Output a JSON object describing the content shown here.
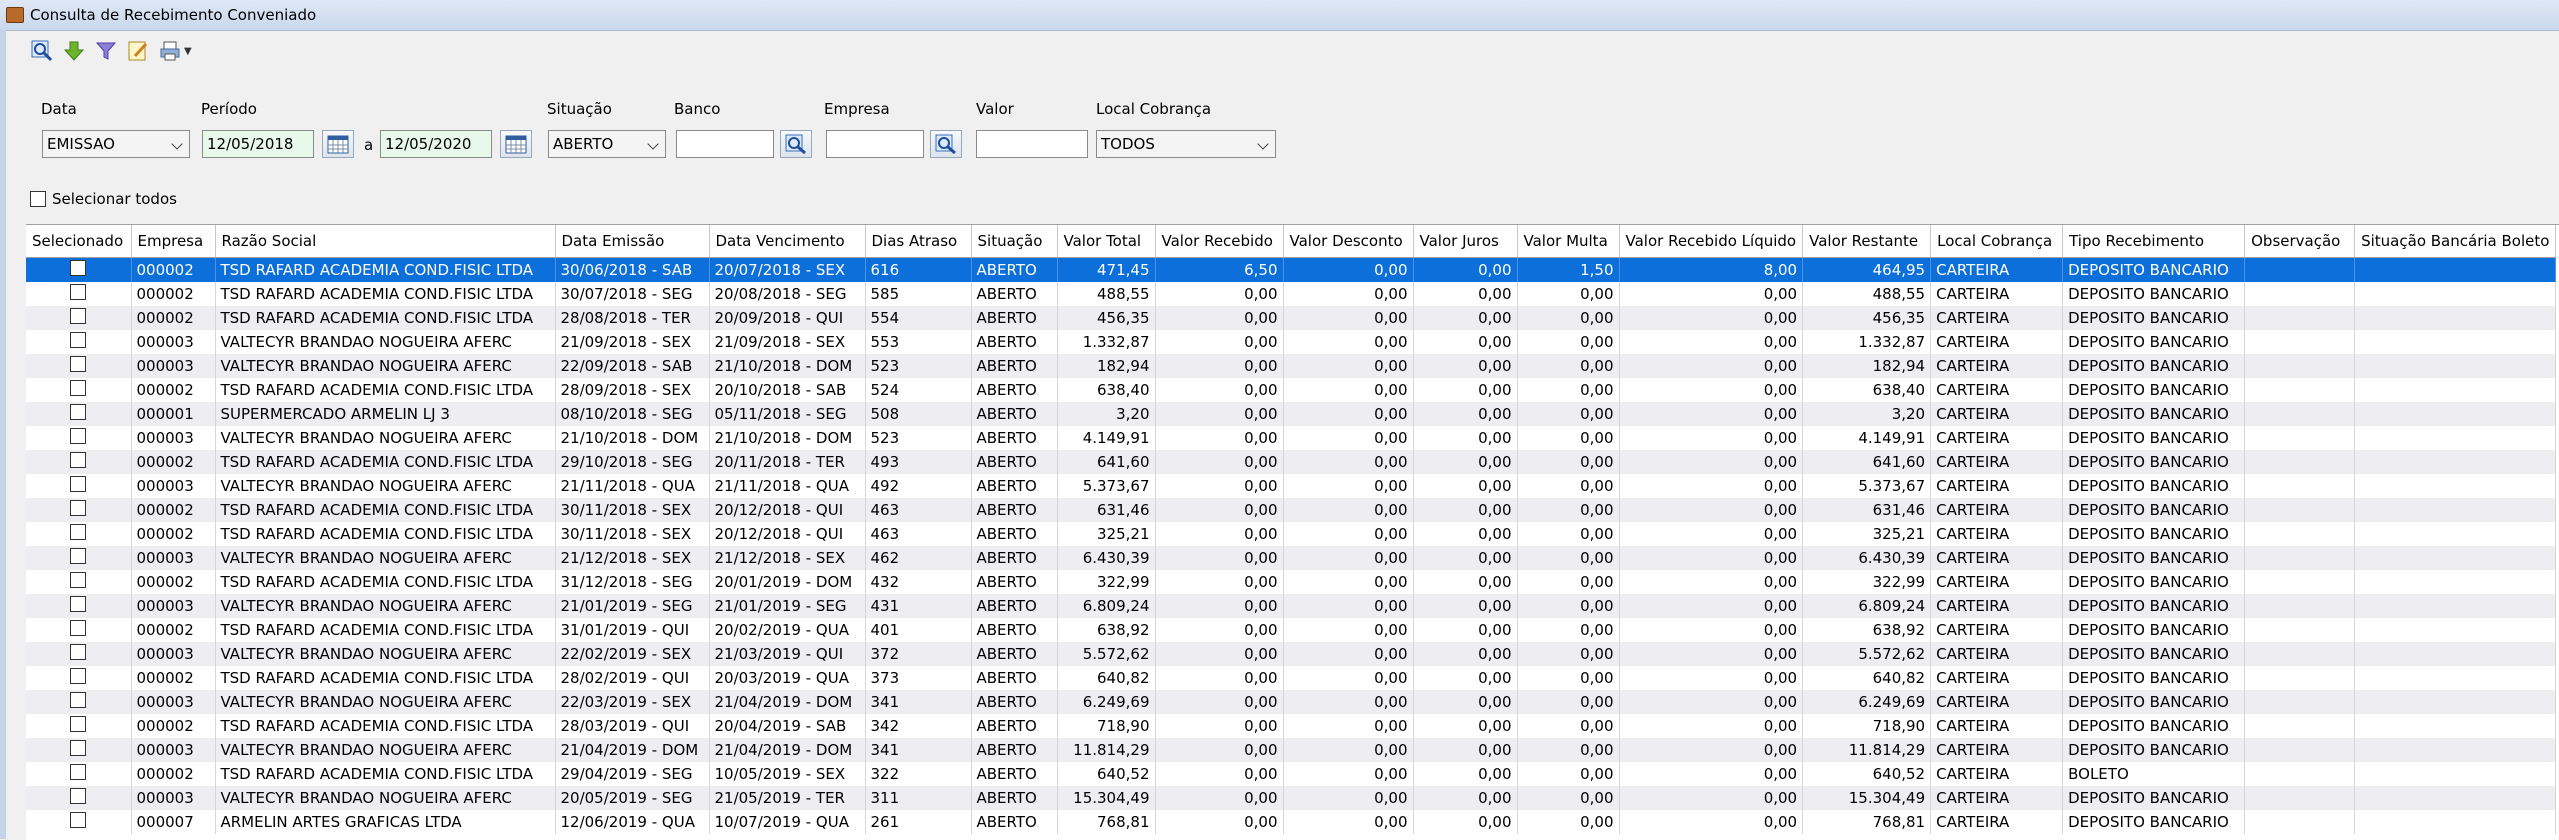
{
  "window": {
    "title": "Consulta de Recebimento Conveniado"
  },
  "toolbar": {
    "icons": [
      "search-icon",
      "download-arrow-icon",
      "filter-icon",
      "edit-icon",
      "print-icon"
    ]
  },
  "filters": {
    "data_label": "Data",
    "data_value": "EMISSAO",
    "periodo_label": "Período",
    "periodo_from": "12/05/2018",
    "periodo_sep": "a",
    "periodo_to": "12/05/2020",
    "situacao_label": "Situação",
    "situacao_value": "ABERTO",
    "banco_label": "Banco",
    "banco_value": "",
    "empresa_label": "Empresa",
    "empresa_value": "",
    "valor_label": "Valor",
    "valor_value": "",
    "local_label": "Local Cobrança",
    "local_value": "TODOS"
  },
  "select_all_label": "Selecionar todos",
  "table": {
    "columns": [
      "Selecionado",
      "Empresa",
      "Razão Social",
      "Data Emissão",
      "Data Vencimento",
      "Dias Atraso",
      "Situação",
      "Valor Total",
      "Valor Recebido",
      "Valor Desconto",
      "Valor Juros",
      "Valor Multa",
      "Valor Recebido Líquido",
      "Valor Restante",
      "Local Cobrança",
      "Tipo Recebimento",
      "Observação",
      "Situação Bancária Boleto"
    ],
    "rows": [
      [
        "000002",
        "TSD RAFARD ACADEMIA COND.FISIC LTDA",
        "30/06/2018 - SAB",
        "20/07/2018 - SEX",
        "616",
        "ABERTO",
        "471,45",
        "6,50",
        "0,00",
        "0,00",
        "1,50",
        "8,00",
        "464,95",
        "CARTEIRA",
        "DEPOSITO BANCARIO",
        "",
        ""
      ],
      [
        "000002",
        "TSD RAFARD ACADEMIA COND.FISIC LTDA",
        "30/07/2018 - SEG",
        "20/08/2018 - SEG",
        "585",
        "ABERTO",
        "488,55",
        "0,00",
        "0,00",
        "0,00",
        "0,00",
        "0,00",
        "488,55",
        "CARTEIRA",
        "DEPOSITO BANCARIO",
        "",
        ""
      ],
      [
        "000002",
        "TSD RAFARD ACADEMIA COND.FISIC LTDA",
        "28/08/2018 - TER",
        "20/09/2018 - QUI",
        "554",
        "ABERTO",
        "456,35",
        "0,00",
        "0,00",
        "0,00",
        "0,00",
        "0,00",
        "456,35",
        "CARTEIRA",
        "DEPOSITO BANCARIO",
        "",
        ""
      ],
      [
        "000003",
        "VALTECYR BRANDAO NOGUEIRA AFERC",
        "21/09/2018 - SEX",
        "21/09/2018 - SEX",
        "553",
        "ABERTO",
        "1.332,87",
        "0,00",
        "0,00",
        "0,00",
        "0,00",
        "0,00",
        "1.332,87",
        "CARTEIRA",
        "DEPOSITO BANCARIO",
        "",
        ""
      ],
      [
        "000003",
        "VALTECYR BRANDAO NOGUEIRA AFERC",
        "22/09/2018 - SAB",
        "21/10/2018 - DOM",
        "523",
        "ABERTO",
        "182,94",
        "0,00",
        "0,00",
        "0,00",
        "0,00",
        "0,00",
        "182,94",
        "CARTEIRA",
        "DEPOSITO BANCARIO",
        "",
        ""
      ],
      [
        "000002",
        "TSD RAFARD ACADEMIA COND.FISIC LTDA",
        "28/09/2018 - SEX",
        "20/10/2018 - SAB",
        "524",
        "ABERTO",
        "638,40",
        "0,00",
        "0,00",
        "0,00",
        "0,00",
        "0,00",
        "638,40",
        "CARTEIRA",
        "DEPOSITO BANCARIO",
        "",
        ""
      ],
      [
        "000001",
        "SUPERMERCADO ARMELIN LJ 3",
        "08/10/2018 - SEG",
        "05/11/2018 - SEG",
        "508",
        "ABERTO",
        "3,20",
        "0,00",
        "0,00",
        "0,00",
        "0,00",
        "0,00",
        "3,20",
        "CARTEIRA",
        "DEPOSITO BANCARIO",
        "",
        ""
      ],
      [
        "000003",
        "VALTECYR BRANDAO NOGUEIRA AFERC",
        "21/10/2018 - DOM",
        "21/10/2018 - DOM",
        "523",
        "ABERTO",
        "4.149,91",
        "0,00",
        "0,00",
        "0,00",
        "0,00",
        "0,00",
        "4.149,91",
        "CARTEIRA",
        "DEPOSITO BANCARIO",
        "",
        ""
      ],
      [
        "000002",
        "TSD RAFARD ACADEMIA COND.FISIC LTDA",
        "29/10/2018 - SEG",
        "20/11/2018 - TER",
        "493",
        "ABERTO",
        "641,60",
        "0,00",
        "0,00",
        "0,00",
        "0,00",
        "0,00",
        "641,60",
        "CARTEIRA",
        "DEPOSITO BANCARIO",
        "",
        ""
      ],
      [
        "000003",
        "VALTECYR BRANDAO NOGUEIRA AFERC",
        "21/11/2018 - QUA",
        "21/11/2018 - QUA",
        "492",
        "ABERTO",
        "5.373,67",
        "0,00",
        "0,00",
        "0,00",
        "0,00",
        "0,00",
        "5.373,67",
        "CARTEIRA",
        "DEPOSITO BANCARIO",
        "",
        ""
      ],
      [
        "000002",
        "TSD RAFARD ACADEMIA COND.FISIC LTDA",
        "30/11/2018 - SEX",
        "20/12/2018 - QUI",
        "463",
        "ABERTO",
        "631,46",
        "0,00",
        "0,00",
        "0,00",
        "0,00",
        "0,00",
        "631,46",
        "CARTEIRA",
        "DEPOSITO BANCARIO",
        "",
        ""
      ],
      [
        "000002",
        "TSD RAFARD ACADEMIA COND.FISIC LTDA",
        "30/11/2018 - SEX",
        "20/12/2018 - QUI",
        "463",
        "ABERTO",
        "325,21",
        "0,00",
        "0,00",
        "0,00",
        "0,00",
        "0,00",
        "325,21",
        "CARTEIRA",
        "DEPOSITO BANCARIO",
        "",
        ""
      ],
      [
        "000003",
        "VALTECYR BRANDAO NOGUEIRA AFERC",
        "21/12/2018 - SEX",
        "21/12/2018 - SEX",
        "462",
        "ABERTO",
        "6.430,39",
        "0,00",
        "0,00",
        "0,00",
        "0,00",
        "0,00",
        "6.430,39",
        "CARTEIRA",
        "DEPOSITO BANCARIO",
        "",
        ""
      ],
      [
        "000002",
        "TSD RAFARD ACADEMIA COND.FISIC LTDA",
        "31/12/2018 - SEG",
        "20/01/2019 - DOM",
        "432",
        "ABERTO",
        "322,99",
        "0,00",
        "0,00",
        "0,00",
        "0,00",
        "0,00",
        "322,99",
        "CARTEIRA",
        "DEPOSITO BANCARIO",
        "",
        ""
      ],
      [
        "000003",
        "VALTECYR BRANDAO NOGUEIRA AFERC",
        "21/01/2019 - SEG",
        "21/01/2019 - SEG",
        "431",
        "ABERTO",
        "6.809,24",
        "0,00",
        "0,00",
        "0,00",
        "0,00",
        "0,00",
        "6.809,24",
        "CARTEIRA",
        "DEPOSITO BANCARIO",
        "",
        ""
      ],
      [
        "000002",
        "TSD RAFARD ACADEMIA COND.FISIC LTDA",
        "31/01/2019 - QUI",
        "20/02/2019 - QUA",
        "401",
        "ABERTO",
        "638,92",
        "0,00",
        "0,00",
        "0,00",
        "0,00",
        "0,00",
        "638,92",
        "CARTEIRA",
        "DEPOSITO BANCARIO",
        "",
        ""
      ],
      [
        "000003",
        "VALTECYR BRANDAO NOGUEIRA AFERC",
        "22/02/2019 - SEX",
        "21/03/2019 - QUI",
        "372",
        "ABERTO",
        "5.572,62",
        "0,00",
        "0,00",
        "0,00",
        "0,00",
        "0,00",
        "5.572,62",
        "CARTEIRA",
        "DEPOSITO BANCARIO",
        "",
        ""
      ],
      [
        "000002",
        "TSD RAFARD ACADEMIA COND.FISIC LTDA",
        "28/02/2019 - QUI",
        "20/03/2019 - QUA",
        "373",
        "ABERTO",
        "640,82",
        "0,00",
        "0,00",
        "0,00",
        "0,00",
        "0,00",
        "640,82",
        "CARTEIRA",
        "DEPOSITO BANCARIO",
        "",
        ""
      ],
      [
        "000003",
        "VALTECYR BRANDAO NOGUEIRA AFERC",
        "22/03/2019 - SEX",
        "21/04/2019 - DOM",
        "341",
        "ABERTO",
        "6.249,69",
        "0,00",
        "0,00",
        "0,00",
        "0,00",
        "0,00",
        "6.249,69",
        "CARTEIRA",
        "DEPOSITO BANCARIO",
        "",
        ""
      ],
      [
        "000002",
        "TSD RAFARD ACADEMIA COND.FISIC LTDA",
        "28/03/2019 - QUI",
        "20/04/2019 - SAB",
        "342",
        "ABERTO",
        "718,90",
        "0,00",
        "0,00",
        "0,00",
        "0,00",
        "0,00",
        "718,90",
        "CARTEIRA",
        "DEPOSITO BANCARIO",
        "",
        ""
      ],
      [
        "000003",
        "VALTECYR BRANDAO NOGUEIRA AFERC",
        "21/04/2019 - DOM",
        "21/04/2019 - DOM",
        "341",
        "ABERTO",
        "11.814,29",
        "0,00",
        "0,00",
        "0,00",
        "0,00",
        "0,00",
        "11.814,29",
        "CARTEIRA",
        "DEPOSITO BANCARIO",
        "",
        ""
      ],
      [
        "000002",
        "TSD RAFARD ACADEMIA COND.FISIC LTDA",
        "29/04/2019 - SEG",
        "10/05/2019 - SEX",
        "322",
        "ABERTO",
        "640,52",
        "0,00",
        "0,00",
        "0,00",
        "0,00",
        "0,00",
        "640,52",
        "CARTEIRA",
        "BOLETO",
        "",
        ""
      ],
      [
        "000003",
        "VALTECYR BRANDAO NOGUEIRA AFERC",
        "20/05/2019 - SEG",
        "21/05/2019 - TER",
        "311",
        "ABERTO",
        "15.304,49",
        "0,00",
        "0,00",
        "0,00",
        "0,00",
        "0,00",
        "15.304,49",
        "CARTEIRA",
        "DEPOSITO BANCARIO",
        "",
        ""
      ],
      [
        "000007",
        "ARMELIN ARTES GRAFICAS LTDA",
        "12/06/2019 - QUA",
        "10/07/2019 - QUA",
        "261",
        "ABERTO",
        "768,81",
        "0,00",
        "0,00",
        "0,00",
        "0,00",
        "0,00",
        "768,81",
        "CARTEIRA",
        "DEPOSITO BANCARIO",
        "",
        ""
      ]
    ]
  }
}
